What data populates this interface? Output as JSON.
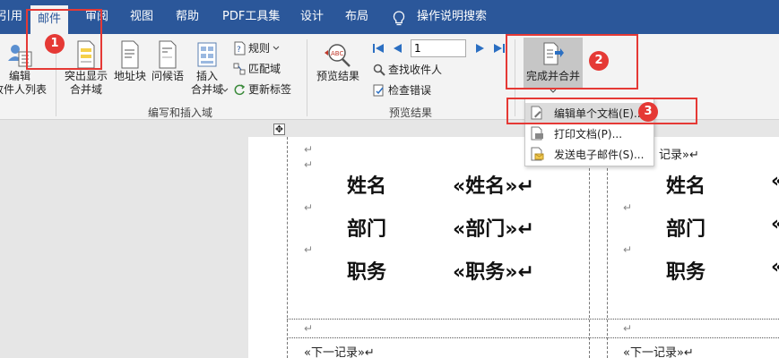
{
  "tabs": [
    {
      "label": "引用"
    },
    {
      "label": "邮件"
    },
    {
      "label": "审阅"
    },
    {
      "label": "视图"
    },
    {
      "label": "帮助"
    },
    {
      "label": "PDF工具集"
    },
    {
      "label": "设计"
    },
    {
      "label": "布局"
    }
  ],
  "tell_me": "操作说明搜索",
  "ribbon": {
    "edit_recipients": "编辑\n收件人列表",
    "highlight": "突出显示\n合并域",
    "address_block": "地址块",
    "greeting": "问候语",
    "insert_field": "插入\n合并域",
    "rules": "规则",
    "match_fields": "匹配域",
    "update_labels": "更新标签",
    "write_group_label": "编写和插入域",
    "preview_results": "预览结果",
    "record_number": "1",
    "find_recipient": "查找收件人",
    "check_errors": "检查错误",
    "preview_group_label": "预览结果",
    "finish_merge": "完成并合并"
  },
  "dropdown": {
    "items": [
      {
        "label": "编辑单个文档(E)..."
      },
      {
        "label": "打印文档(P)..."
      },
      {
        "label": "发送电子邮件(S)..."
      }
    ]
  },
  "document": {
    "pmark": "↵",
    "cells": [
      {
        "rows": [
          {
            "name": "姓名",
            "field": "«姓名»↵"
          },
          {
            "name": "部门",
            "field": "«部门»↵"
          },
          {
            "name": "职务",
            "field": "«职务»↵"
          }
        ]
      },
      {
        "rows": [
          {
            "name": "姓名",
            "field": "«"
          },
          {
            "name": "部门",
            "field": "«"
          },
          {
            "name": "职务",
            "field": "«"
          }
        ]
      }
    ],
    "top_right_partial": "记录»↵",
    "next_record": "«下一记录»↵"
  },
  "badges": [
    "1",
    "2",
    "3"
  ],
  "colors": {
    "tabbar": "#2b579a",
    "ribbon": "#f3f3f3",
    "annotation": "#e53935"
  }
}
